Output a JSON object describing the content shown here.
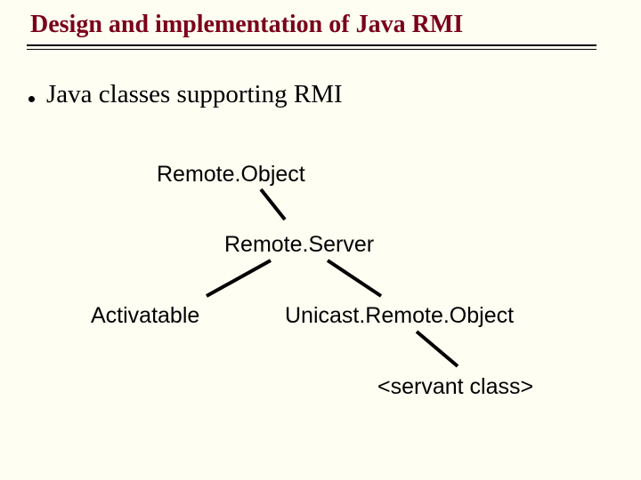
{
  "title": "Design and implementation of Java RMI",
  "bullet": "Java classes supporting RMI",
  "nodes": {
    "remoteObject": "Remote.Object",
    "remoteServer": "Remote.Server",
    "activatable": "Activatable",
    "unicast": "Unicast.Remote.Object",
    "servant": "<servant class>"
  }
}
